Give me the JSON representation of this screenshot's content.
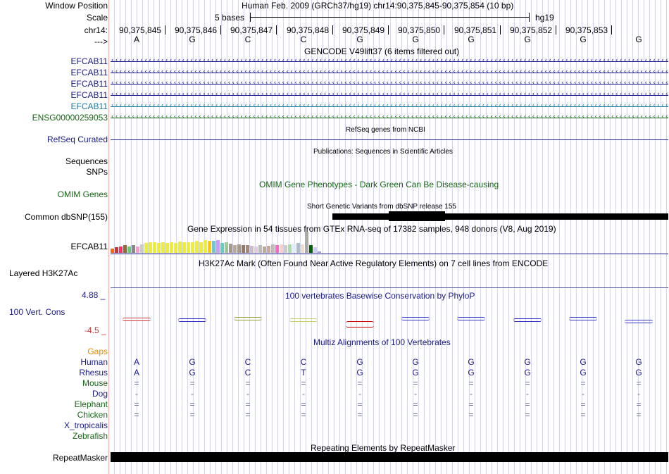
{
  "header": {
    "window_position_label": "Window Position",
    "scale_label": "Scale",
    "chrom_label": "chr14:",
    "arrow_label": "--->",
    "assembly_title": "Human Feb. 2009 (GRCh37/hg19)   chr14:90,375,845-90,375,854 (10 bp)",
    "scale_text": "5 bases",
    "scale_db": "hg19"
  },
  "positions": [
    "90,375,845",
    "90,375,846",
    "90,375,847",
    "90,375,848",
    "90,375,849",
    "90,375,850",
    "90,375,851",
    "90,375,852",
    "90,375,853"
  ],
  "bases": [
    "A",
    "G",
    "C",
    "C",
    "G",
    "G",
    "G",
    "G",
    "G",
    "G"
  ],
  "gencode": {
    "title": "GENCODE V49lift37 (6 items filtered out)",
    "items": [
      {
        "label": "EFCAB11",
        "color": "#1a1a8c"
      },
      {
        "label": "EFCAB11",
        "color": "#1a1a8c"
      },
      {
        "label": "EFCAB11",
        "color": "#1a1a8c"
      },
      {
        "label": "EFCAB11",
        "color": "#1a1a8c"
      },
      {
        "label": "EFCAB11",
        "color": "#1a7aa0"
      },
      {
        "label": "ENSG00000259053",
        "color": "#176617"
      }
    ]
  },
  "refseq": {
    "title": "RefSeq genes from NCBI",
    "label": "RefSeq Curated"
  },
  "publications": {
    "title": "Publications: Sequences in Scientific Articles",
    "label": "Sequences"
  },
  "snps": {
    "label": "SNPs"
  },
  "omim": {
    "title": "OMIM Gene Phenotypes - Dark Green Can Be Disease-causing",
    "label": "OMIM Genes"
  },
  "dbsnp": {
    "title": "Short Genetic Variants from dbSNP release 155",
    "label": "Common dbSNP(155)"
  },
  "gtex": {
    "title": "Gene Expression in 54 tissues from GTEx RNA-seq of 17382 samples, 948 donors (V8, Aug 2019)",
    "label": "EFCAB11",
    "bar_colors": [
      "#ff6600",
      "#cc3333",
      "#ff3366",
      "#996633",
      "#66cc66",
      "#888888",
      "#ff99cc",
      "#cccccc",
      "#eeee33",
      "#eeee33",
      "#eeee33",
      "#eeee33",
      "#eeee33",
      "#eeee33",
      "#eeee33",
      "#eeee33",
      "#eeee33",
      "#eeee33",
      "#eeee33",
      "#eeee33",
      "#eeee33",
      "#eeee33",
      "#eeee33",
      "#ffcc00",
      "#66cccc",
      "#cc99ff",
      "#66cccc",
      "#99cc99",
      "#aa9988",
      "#bbaa99",
      "#aa9988",
      "#997766",
      "#aa8877",
      "#ccbbcc",
      "#ddccdd",
      "#bbbbbb",
      "#bbaa99",
      "#ccaa99",
      "#bbbbbb",
      "#ff66cc",
      "#ffcccc",
      "#cccccc",
      "#aaddaa",
      "#ddeeff",
      "#aabbcc",
      "#eeddcc",
      "#aaaaaa",
      "#006600",
      "#ccccff",
      "#9999ff"
    ],
    "bar_values": [
      0.2,
      0.28,
      0.3,
      0.35,
      0.3,
      0.35,
      0.3,
      0.4,
      0.45,
      0.5,
      0.5,
      0.48,
      0.5,
      0.45,
      0.5,
      0.48,
      0.52,
      0.5,
      0.5,
      0.5,
      0.55,
      0.5,
      0.6,
      0.55,
      0.55,
      0.6,
      0.45,
      0.5,
      0.42,
      0.38,
      0.4,
      0.38,
      0.35,
      0.33,
      0.3,
      0.35,
      0.3,
      0.33,
      0.4,
      0.35,
      0.4,
      0.35,
      0.4,
      0.42,
      0.45,
      0.4,
      1.0,
      0.38,
      0.25,
      0.08
    ]
  },
  "h3k27ac": {
    "title": "H3K27Ac Mark (Often Found Near Active Regulatory Elements) on 7 cell lines from ENCODE",
    "label": "Layered H3K27Ac"
  },
  "phylop": {
    "title": "100 vertebrates Basewise Conservation by PhyloP",
    "label": "100 Vert. Cons",
    "ymax": "4.88 _",
    "ymin": "-4.5 _",
    "base_colors": [
      "#cc3333",
      "#3333cc",
      "#999933",
      "#cccc66",
      "#cc0000",
      "#3333cc",
      "#3333cc",
      "#3333cc",
      "#3333cc",
      "#3333cc"
    ]
  },
  "multiz": {
    "title": "Multiz Alignments of 100 Vertebrates",
    "gaps_label": "Gaps",
    "species": [
      {
        "name": "Human",
        "values": [
          "A",
          "G",
          "C",
          "C",
          "G",
          "G",
          "G",
          "G",
          "G",
          "G"
        ],
        "color": "#1a1a8c"
      },
      {
        "name": "Rhesus",
        "values": [
          "A",
          "G",
          "C",
          "T",
          "G",
          "G",
          "G",
          "G",
          "G",
          "G"
        ],
        "color": "#1a1a8c"
      },
      {
        "name": "Mouse",
        "values": [
          "=",
          "=",
          "=",
          "=",
          "=",
          "=",
          "=",
          "=",
          "=",
          "="
        ],
        "color": "#176617"
      },
      {
        "name": "Dog",
        "values": [
          "-",
          "-",
          "-",
          "-",
          "-",
          "-",
          "-",
          "-",
          "-",
          "-"
        ],
        "color": "#1a1a8c"
      },
      {
        "name": "Elephant",
        "values": [
          "=",
          "=",
          "=",
          "=",
          "=",
          "=",
          "=",
          "=",
          "=",
          "="
        ],
        "color": "#176617"
      },
      {
        "name": "Chicken",
        "values": [
          "=",
          "=",
          "=",
          "=",
          "=",
          "=",
          "=",
          "=",
          "=",
          "="
        ],
        "color": "#176617"
      },
      {
        "name": "X_tropicalis",
        "values": [
          "",
          "",
          "",
          "",
          "",
          "",
          "",
          "",
          "",
          ""
        ],
        "color": "#1a1a8c"
      },
      {
        "name": "Zebrafish",
        "values": [
          "",
          "",
          "",
          "",
          "",
          "",
          "",
          "",
          "",
          ""
        ],
        "color": "#176617"
      }
    ]
  },
  "repeatmasker": {
    "title": "Repeating Elements by RepeatMasker",
    "label": "RepeatMasker"
  },
  "colors": {
    "gaps": "#e08a00",
    "omim": "#176617",
    "navy": "#1a1a8c"
  }
}
